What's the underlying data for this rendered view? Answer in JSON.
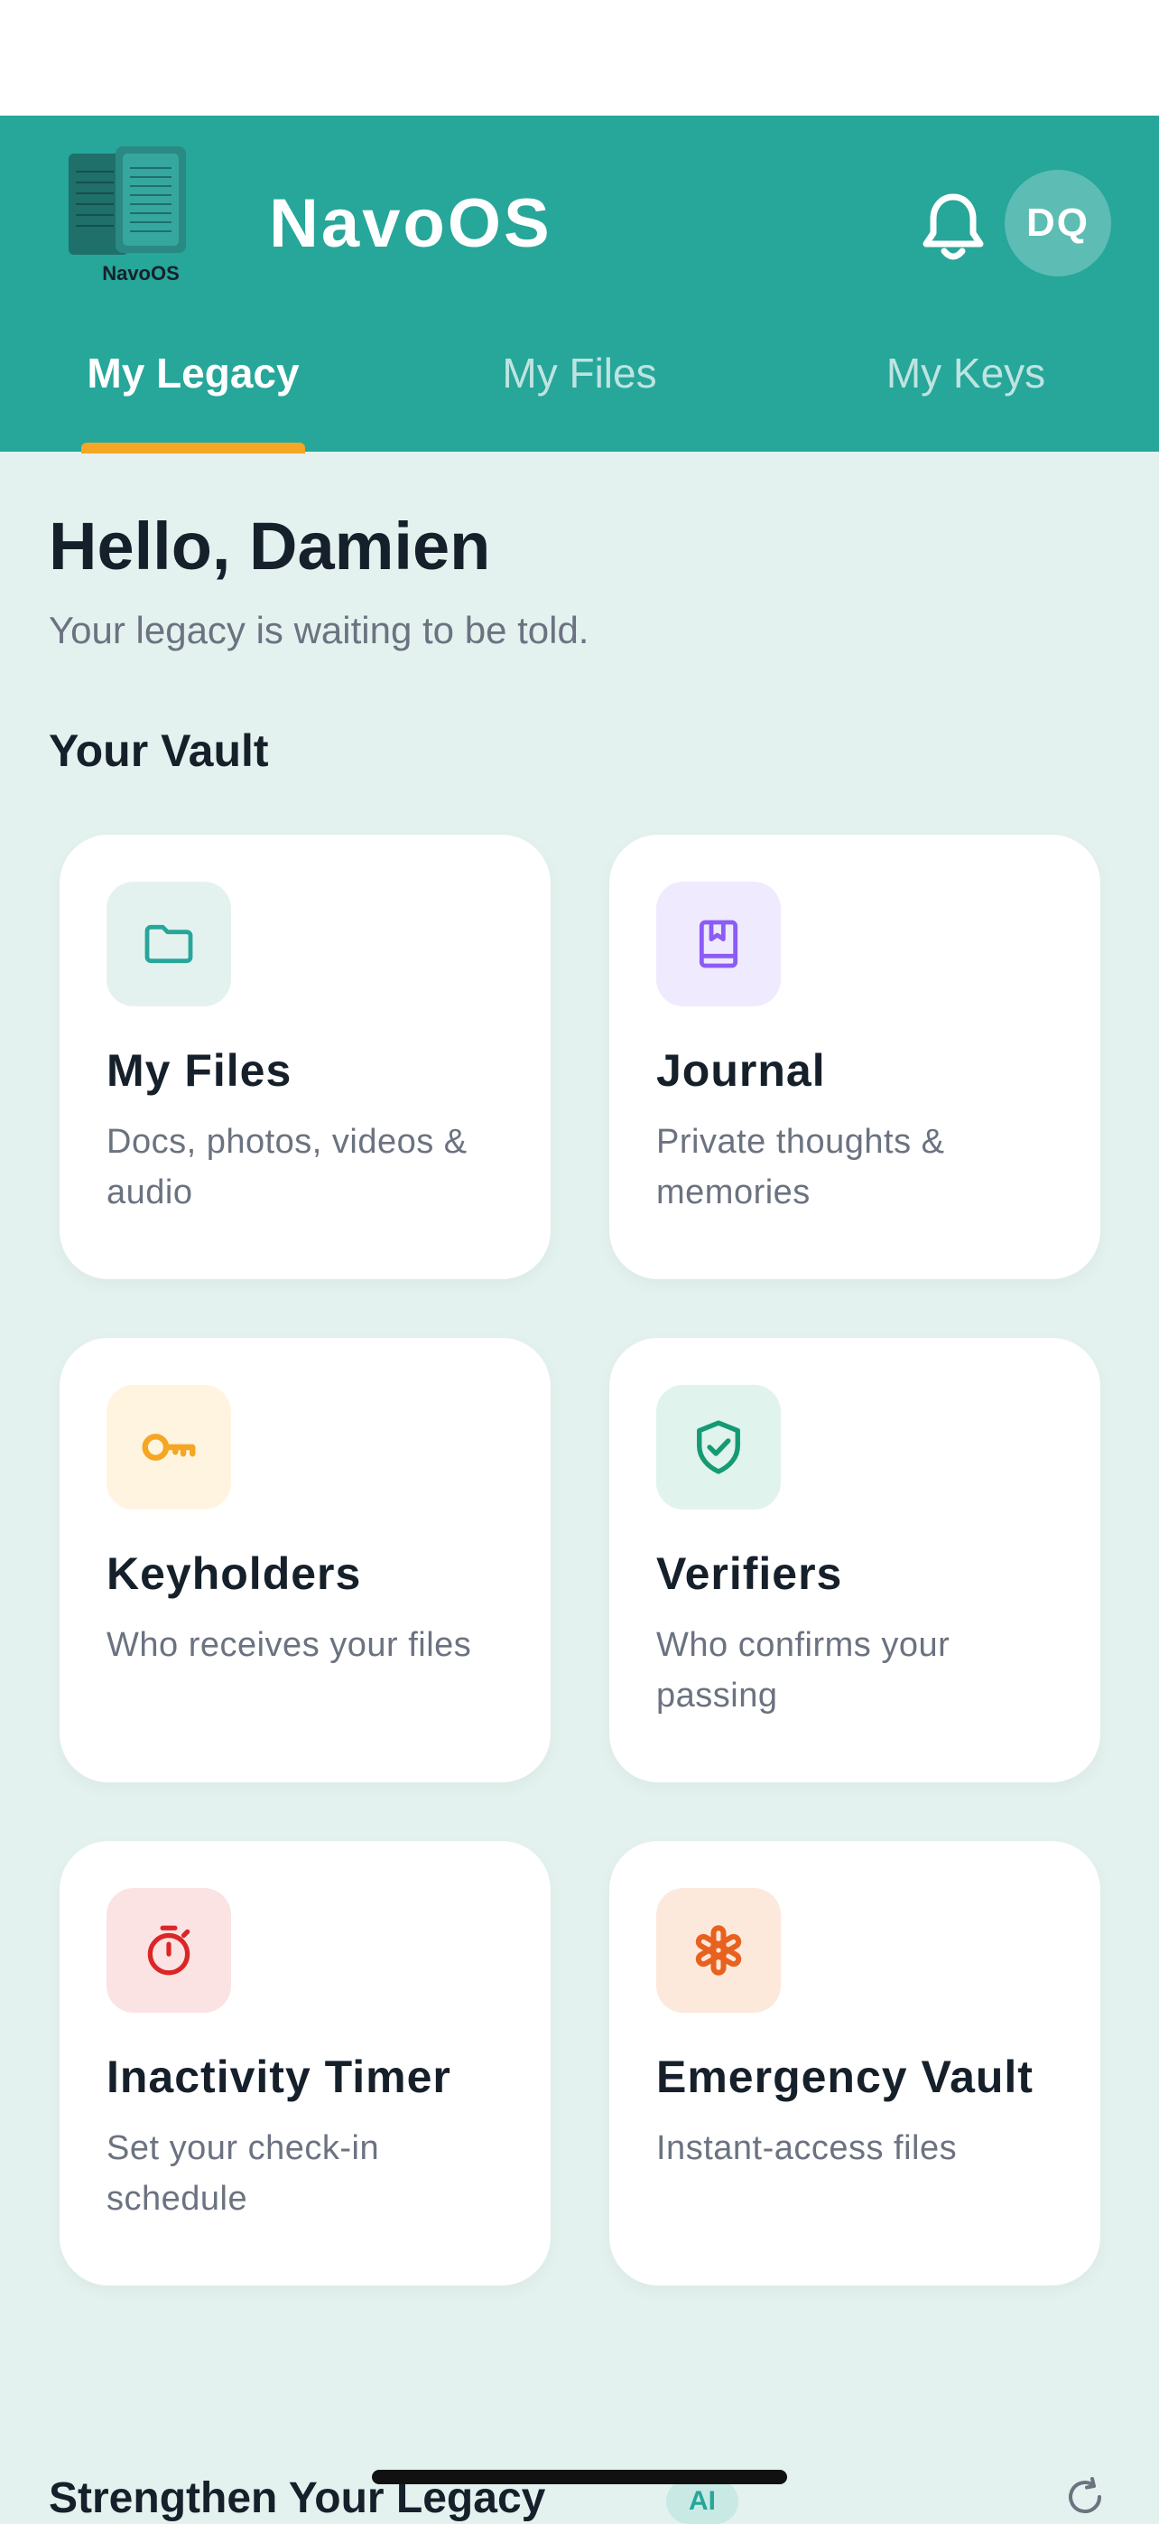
{
  "app": {
    "title": "NavoOS",
    "logo_caption": "NavoOS",
    "avatar_initials": "DQ"
  },
  "tabs": [
    {
      "label": "My Legacy",
      "active": true
    },
    {
      "label": "My Files",
      "active": false
    },
    {
      "label": "My Keys",
      "active": false
    }
  ],
  "greeting": {
    "title": "Hello, Damien",
    "subtitle": "Your legacy is waiting to be told."
  },
  "vault": {
    "title": "Your Vault",
    "cards": [
      {
        "title": "My Files",
        "desc": "Docs, photos, videos & audio",
        "icon": "folder-icon",
        "icon_color": "#27a69a",
        "icon_bg": "#e4f2ef"
      },
      {
        "title": "Journal",
        "desc": "Private thoughts & memories",
        "icon": "book-icon",
        "icon_color": "#8b5cf6",
        "icon_bg": "#efeafd"
      },
      {
        "title": "Keyholders",
        "desc": "Who receives your files",
        "icon": "key-icon",
        "icon_color": "#f5a623",
        "icon_bg": "#fff4e0"
      },
      {
        "title": "Verifiers",
        "desc": "Who confirms your passing",
        "icon": "shield-check-icon",
        "icon_color": "#159a74",
        "icon_bg": "#e0f3ec"
      },
      {
        "title": "Inactivity Timer",
        "desc": "Set your check-in schedule",
        "icon": "timer-icon",
        "icon_color": "#dc2626",
        "icon_bg": "#fbe3e3"
      },
      {
        "title": "Emergency Vault",
        "desc": "Instant-access files",
        "icon": "asterisk-icon",
        "icon_color": "#e8621f",
        "icon_bg": "#fde8dc"
      }
    ]
  },
  "strengthen": {
    "title": "Strengthen Your Legacy",
    "badge": "AI"
  },
  "colors": {
    "header": "#27a69a",
    "background": "#e4f2ef",
    "tab_indicator": "#f5a623"
  }
}
